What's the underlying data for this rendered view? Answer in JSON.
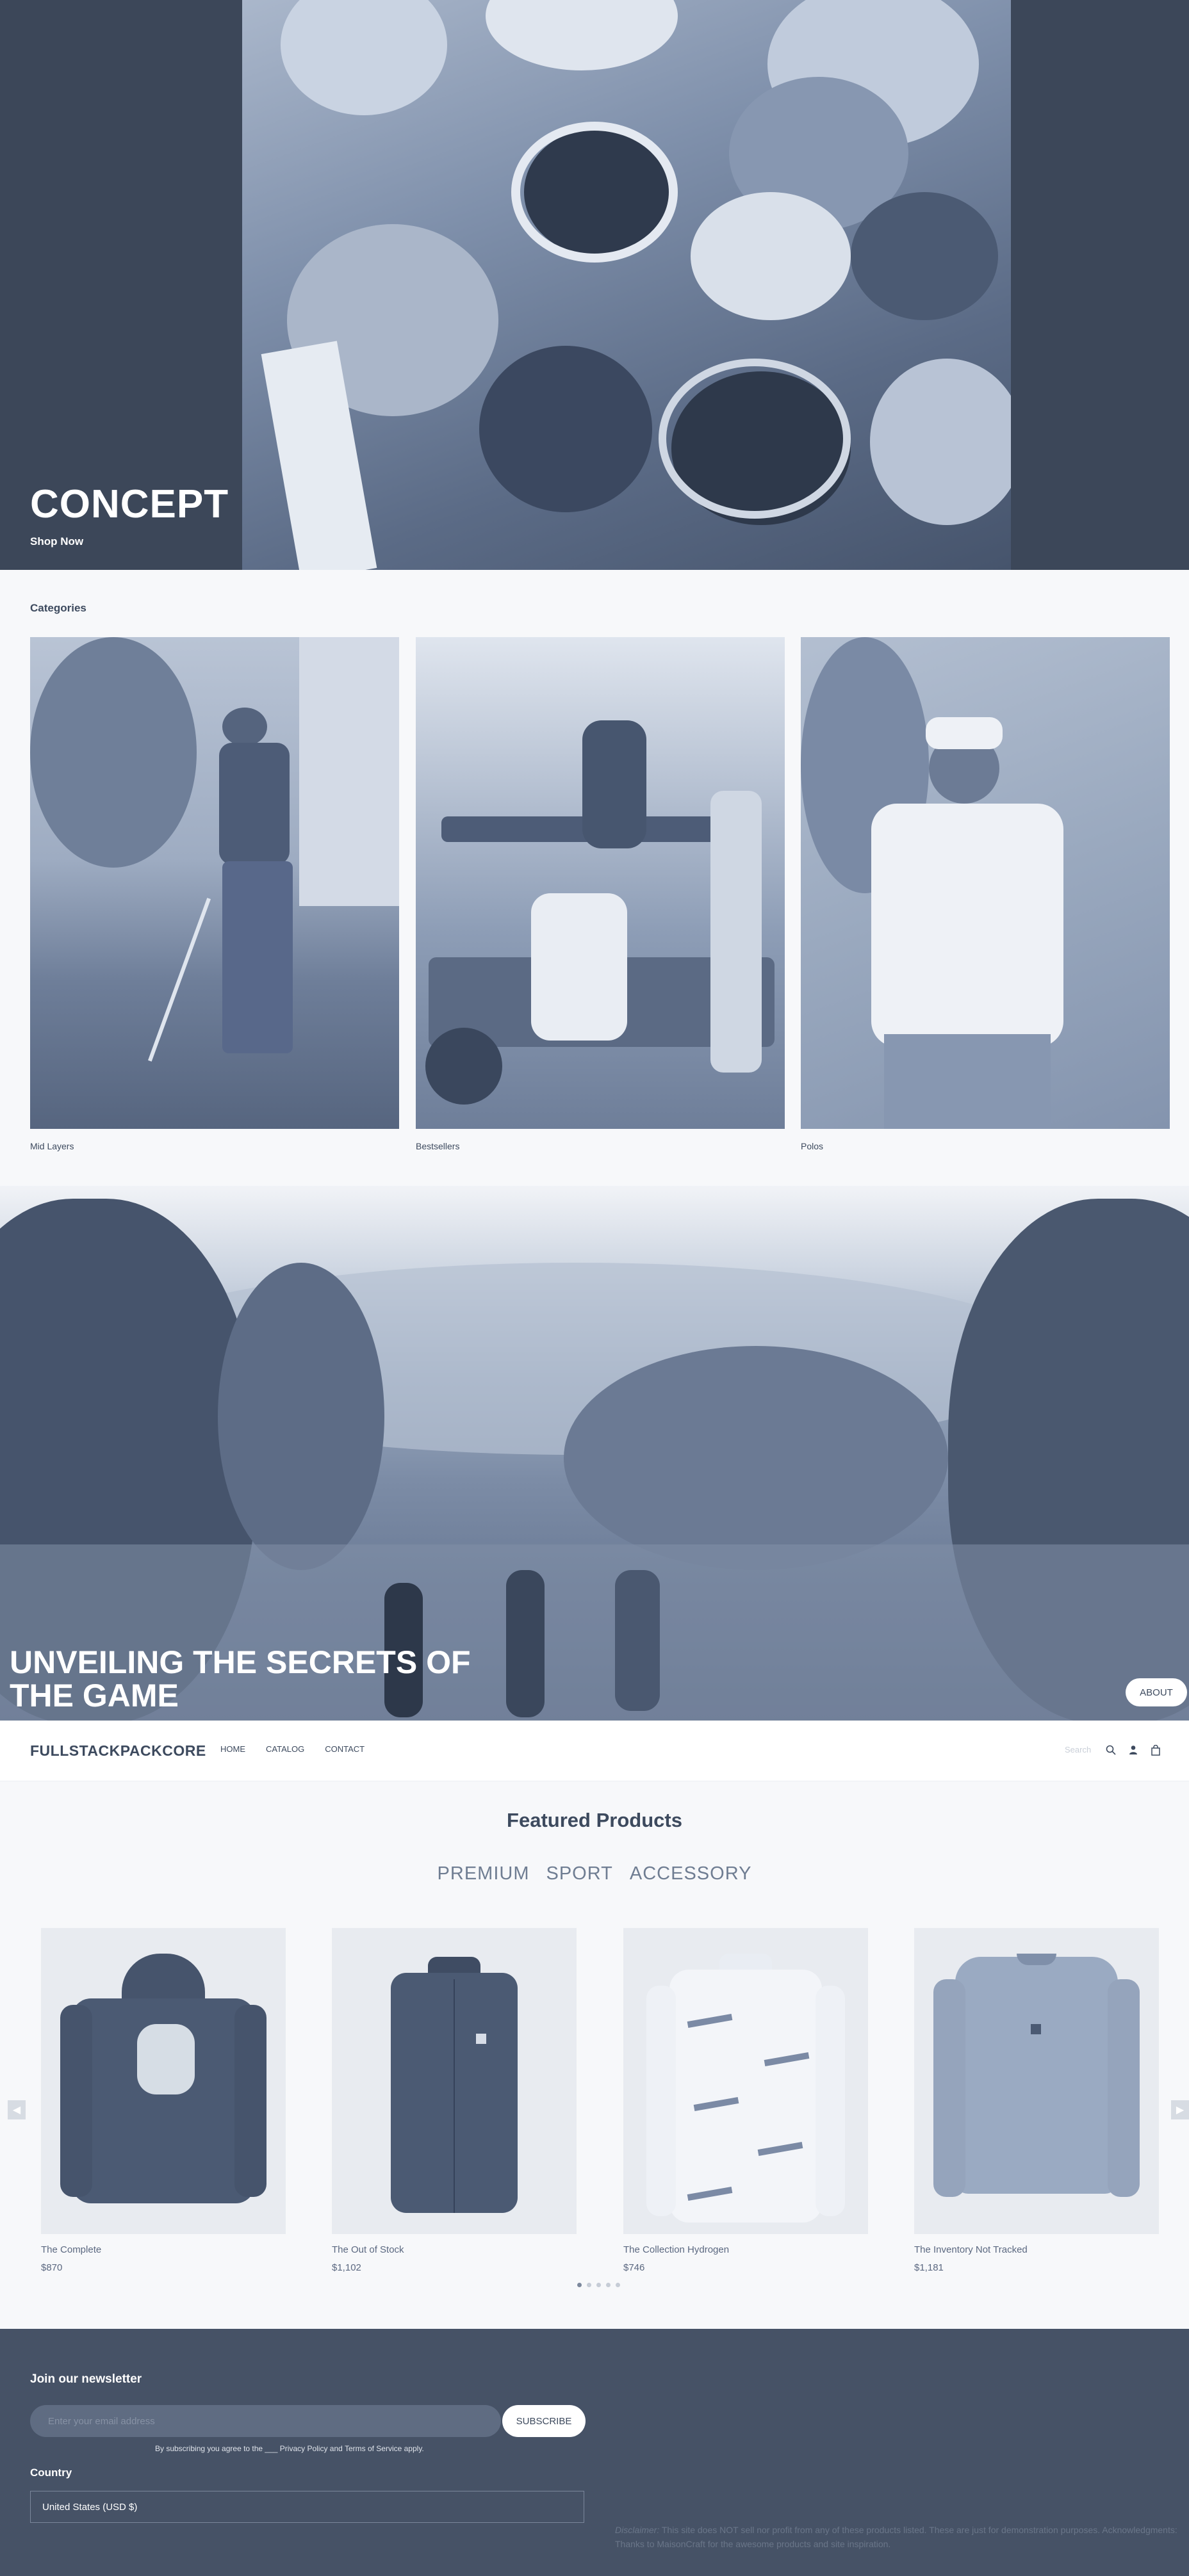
{
  "hero": {
    "title": "CONCEPT",
    "link": "Shop Now"
  },
  "categories": {
    "heading": "Categories",
    "items": [
      {
        "label": "Mid Layers"
      },
      {
        "label": "Bestsellers"
      },
      {
        "label": "Polos"
      }
    ]
  },
  "banner": {
    "title": "UNVEILING THE SECRETS OF THE GAME",
    "button": "ABOUT"
  },
  "header": {
    "logo": "FULLSTACKPACKCORE",
    "nav": [
      "HOME",
      "CATALOG",
      "CONTACT"
    ],
    "search_placeholder": "Search"
  },
  "featured": {
    "title": "Featured Products",
    "tabs": [
      "PREMIUM",
      "SPORT",
      "ACCESSORY"
    ],
    "products": [
      {
        "name": "The Complete",
        "price": "$870"
      },
      {
        "name": "The Out of Stock",
        "price": "$1,102"
      },
      {
        "name": "The Collection Hydrogen",
        "price": "$746"
      },
      {
        "name": "The Inventory Not Tracked",
        "price": "$1,181"
      }
    ],
    "pagination_dots": 5,
    "active_dot": 0
  },
  "footer": {
    "newsletter_heading": "Join our newsletter",
    "email_placeholder": "Enter your email address",
    "subscribe": "SUBSCRIBE",
    "consent": "By subscribing you agree to the ___ Privacy Policy and Terms of Service apply.",
    "country_heading": "Country",
    "country_value": "United States (USD $)",
    "disclaimer_label": "Disclaimer:",
    "disclaimer_text": "This site does NOT sell nor profit from any of these products listed. These are just for demonstration purposes. Acknowledgments: Thanks to MaisonCraft for the awesome products and site inspiration."
  },
  "colors": {
    "hero_bg": "#3c4759",
    "footer_bg": "#465266",
    "text": "#3d4a5e",
    "product_bg": "#e8ebf0"
  }
}
